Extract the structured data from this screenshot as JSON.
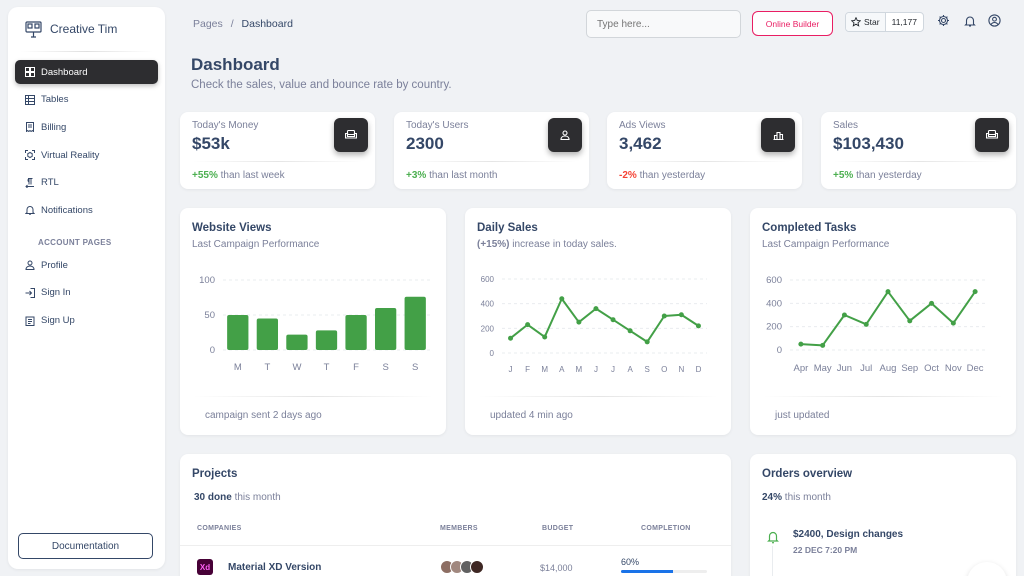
{
  "brand": {
    "name": "Creative Tim"
  },
  "nav": {
    "items": [
      {
        "label": "Dashboard",
        "icon": "dashboard-icon",
        "active": true
      },
      {
        "label": "Tables",
        "icon": "table-icon"
      },
      {
        "label": "Billing",
        "icon": "receipt-icon"
      },
      {
        "label": "Virtual Reality",
        "icon": "view-in-ar-icon"
      },
      {
        "label": "RTL",
        "icon": "format-text-direction-icon"
      },
      {
        "label": "Notifications",
        "icon": "bell-icon"
      }
    ],
    "section_heading": "ACCOUNT PAGES",
    "account_items": [
      {
        "label": "Profile",
        "icon": "person-icon"
      },
      {
        "label": "Sign In",
        "icon": "login-icon"
      },
      {
        "label": "Sign Up",
        "icon": "assignment-icon"
      }
    ],
    "documentation_label": "Documentation"
  },
  "topbar": {
    "breadcrumb_parent": "Pages",
    "breadcrumb_separator": "/",
    "breadcrumb_current": "Dashboard",
    "search_placeholder": "Type here...",
    "online_builder_label": "Online Builder",
    "star_label": "Star",
    "star_count": "11,177"
  },
  "header": {
    "title": "Dashboard",
    "subtitle": "Check the sales, value and bounce rate by country."
  },
  "stats": [
    {
      "label": "Today's Money",
      "value": "$53k",
      "change": "+55%",
      "change_type": "positive",
      "suffix": "than last week",
      "icon": "weekend-icon"
    },
    {
      "label": "Today's Users",
      "value": "2300",
      "change": "+3%",
      "change_type": "positive",
      "suffix": "than last month",
      "icon": "person-icon"
    },
    {
      "label": "Ads Views",
      "value": "3,462",
      "change": "-2%",
      "change_type": "negative",
      "suffix": "than yesterday",
      "icon": "leaderboard-icon"
    },
    {
      "label": "Sales",
      "value": "$103,430",
      "change": "+5%",
      "change_type": "positive",
      "suffix": "than yesterday",
      "icon": "weekend-icon"
    }
  ],
  "charts": {
    "website_views": {
      "title": "Website Views",
      "subtitle": "Last Campaign Performance",
      "footer": "campaign sent 2 days ago"
    },
    "daily_sales": {
      "title": "Daily Sales",
      "subtitle_emph": "(+15%)",
      "subtitle": "increase in today sales.",
      "footer": "updated 4 min ago"
    },
    "completed_tasks": {
      "title": "Completed Tasks",
      "subtitle": "Last Campaign Performance",
      "footer": "just updated"
    }
  },
  "chart_data": [
    {
      "type": "bar",
      "title": "Website Views",
      "categories": [
        "M",
        "T",
        "W",
        "T",
        "F",
        "S",
        "S"
      ],
      "values": [
        50,
        45,
        22,
        28,
        50,
        60,
        76
      ],
      "ylim": [
        0,
        100
      ],
      "yticks": [
        0,
        50,
        100
      ],
      "color": "#43a047"
    },
    {
      "type": "line",
      "title": "Daily Sales",
      "categories": [
        "J",
        "F",
        "M",
        "A",
        "M",
        "J",
        "J",
        "A",
        "S",
        "O",
        "N",
        "D"
      ],
      "values": [
        120,
        230,
        130,
        440,
        250,
        360,
        270,
        180,
        90,
        300,
        310,
        220
      ],
      "ylim": [
        0,
        600
      ],
      "yticks": [
        0,
        200,
        400,
        600
      ],
      "color": "#43a047"
    },
    {
      "type": "line",
      "title": "Completed Tasks",
      "categories": [
        "Apr",
        "May",
        "Jun",
        "Jul",
        "Aug",
        "Sep",
        "Oct",
        "Nov",
        "Dec"
      ],
      "values": [
        50,
        40,
        300,
        220,
        500,
        250,
        400,
        230,
        500
      ],
      "ylim": [
        0,
        600
      ],
      "yticks": [
        0,
        200,
        400,
        600
      ],
      "color": "#43a047"
    }
  ],
  "projects": {
    "title": "Projects",
    "done": "30 done",
    "done_suffix": "this month",
    "columns": [
      "COMPANIES",
      "MEMBERS",
      "BUDGET",
      "COMPLETION"
    ],
    "rows": [
      {
        "logo": "Xd",
        "name": "Material XD Version",
        "budget": "$14,000",
        "completion": "60%",
        "completion_value": 0.6
      }
    ]
  },
  "orders": {
    "title": "Orders overview",
    "pct": "24%",
    "pct_suffix": "this month",
    "items": [
      {
        "title": "$2400, Design changes",
        "date": "22 DEC 7:20 PM",
        "icon": "notification-bell-icon"
      }
    ]
  },
  "colors": {
    "accent_dark": "#2d2d30",
    "success": "#4caf50",
    "danger": "#f44335",
    "brand_pink": "#e91e63"
  }
}
